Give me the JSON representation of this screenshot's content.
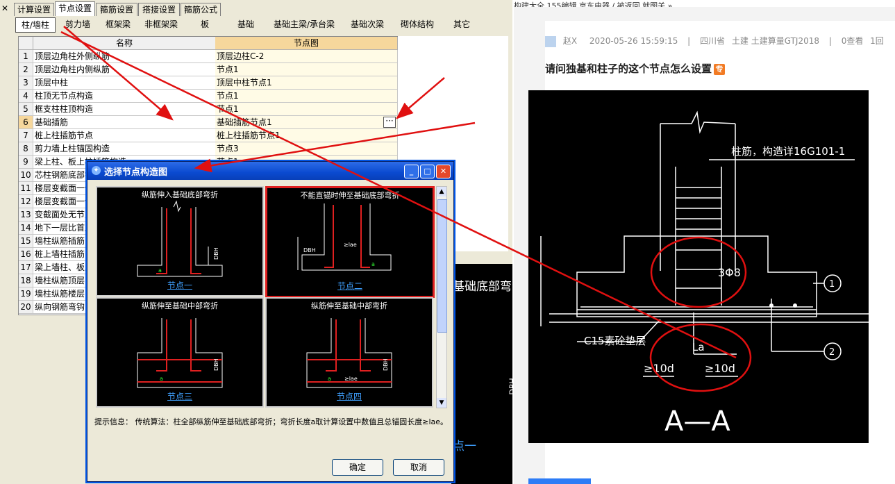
{
  "top_tabs": {
    "close": "✕",
    "items": [
      "计算设置",
      "节点设置",
      "箍筋设置",
      "搭接设置",
      "箍筋公式"
    ]
  },
  "sub_tabs": [
    "柱/墙柱",
    "剪力墙",
    "框架梁",
    "非框架梁",
    "板",
    "基础",
    "基础主梁/承台梁",
    "基础次梁",
    "砌体结构",
    "其它"
  ],
  "grid": {
    "headers": [
      "名称",
      "节点图"
    ],
    "rows": [
      {
        "n": "1",
        "name": "顶层边角柱外侧纵筋",
        "value": "顶层边柱C-2"
      },
      {
        "n": "2",
        "name": "顶层边角柱内侧纵筋",
        "value": "节点1"
      },
      {
        "n": "3",
        "name": "顶层中柱",
        "value": "顶层中柱节点1"
      },
      {
        "n": "4",
        "name": "柱顶无节点构造",
        "value": "节点1"
      },
      {
        "n": "5",
        "name": "框支柱柱顶构造",
        "value": "节点1"
      },
      {
        "n": "6",
        "name": "基础插筋",
        "value": "基础插筋节点1"
      },
      {
        "n": "7",
        "name": "桩上柱插筋节点",
        "value": "桩上柱插筋节点1"
      },
      {
        "n": "8",
        "name": "剪力墙上柱锚固构造",
        "value": "节点3"
      },
      {
        "n": "9",
        "name": "梁上柱、板上柱插筋构造",
        "value": "节点1"
      },
      {
        "n": "10",
        "name": "芯柱钢筋底部锚固",
        "value": ""
      },
      {
        "n": "11",
        "name": "楼层变截面一侧",
        "value": ""
      },
      {
        "n": "12",
        "name": "楼层变截面一侧",
        "value": ""
      },
      {
        "n": "13",
        "name": "变截面处无节点",
        "value": ""
      },
      {
        "n": "14",
        "name": "地下一层比首层",
        "value": ""
      },
      {
        "n": "15",
        "name": "墙柱纵筋插筋",
        "value": ""
      },
      {
        "n": "16",
        "name": "桩上墙柱插筋",
        "value": ""
      },
      {
        "n": "17",
        "name": "梁上墙柱、板上",
        "value": ""
      },
      {
        "n": "18",
        "name": "墙柱纵筋顶层",
        "value": ""
      },
      {
        "n": "19",
        "name": "墙柱纵筋楼层",
        "value": ""
      },
      {
        "n": "20",
        "name": "纵向钢筋弯钩",
        "value": ""
      }
    ],
    "ellipsis": "···"
  },
  "behind_dialog": {
    "title": "基础底部弯",
    "node": "点一",
    "dbh": "DBH"
  },
  "dialog": {
    "title": "选择节点构造图",
    "min": "_",
    "max": "□",
    "close": "✕",
    "thumbs": [
      {
        "caption": "纵筋伸入基础底部弯折",
        "node": "节点一"
      },
      {
        "caption": "不能直锚时伸至基础底部弯折",
        "node": "节点二"
      },
      {
        "caption": "纵筋伸至基础中部弯折",
        "node": "节点三"
      },
      {
        "caption": "纵筋伸至基础中部弯折",
        "node": "节点四"
      }
    ],
    "thumb_labels": {
      "a": "a",
      "dbh": "DBH",
      "lae": "≥lae"
    },
    "hint": "提示信息： 传统算法：柱全部纵筋伸至基础底部弯折；弯折长度a取计算设置中数值且总锚固长度≥lae。",
    "ok": "确定",
    "cancel": "取消"
  },
  "browser": {
    "bar_text": "构建大全  155编辑  京东电器  / 被返回  就图关  »"
  },
  "article": {
    "author": "赵X",
    "date": "2020-05-26 15:59:15",
    "location": "四川省",
    "category": "土建 土建算量GTJ2018",
    "views": "0查看",
    "replies": "1回",
    "title": "请问独基和柱子的这个节点怎么设置",
    "badge": "专"
  },
  "cad": {
    "note": "柱筋，构造详16G101-1",
    "rebar": "3Φ8",
    "cushion": "C15素砼垫层",
    "la": "La",
    "ten_d_left": "≥10d",
    "ten_d_right": "≥10d",
    "section": "A—A",
    "marker1": "1",
    "marker2": "2"
  },
  "colors": {
    "window_bg": "#ece9d8",
    "title_bar": "#0a4ad0",
    "arrow_red": "#e01010",
    "selected_border": "#e02020",
    "node_link": "#3fa0ff"
  }
}
